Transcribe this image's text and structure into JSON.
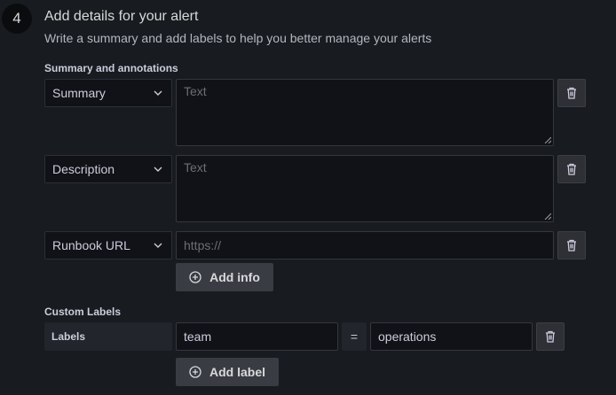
{
  "step": {
    "number": "4",
    "title": "Add details for your alert",
    "subtitle": "Write a summary and add labels to help you better manage your alerts"
  },
  "annotations": {
    "section_label": "Summary and annotations",
    "rows": [
      {
        "key": "Summary",
        "placeholder": "Text"
      },
      {
        "key": "Description",
        "placeholder": "Text"
      },
      {
        "key": "Runbook URL",
        "placeholder": "https://"
      }
    ],
    "add_button_label": "Add info"
  },
  "custom_labels": {
    "section_label": "Custom Labels",
    "labels_tag": "Labels",
    "rows": [
      {
        "key": "team",
        "operator": "=",
        "value": "operations"
      }
    ],
    "add_button_label": "Add label"
  },
  "icons": {
    "delete": "trash-icon",
    "dropdown": "chevron-down-icon",
    "add": "plus-circle-icon"
  },
  "colors": {
    "background": "#181b1f",
    "input_background": "#111217",
    "button_secondary": "#3a3c44"
  }
}
